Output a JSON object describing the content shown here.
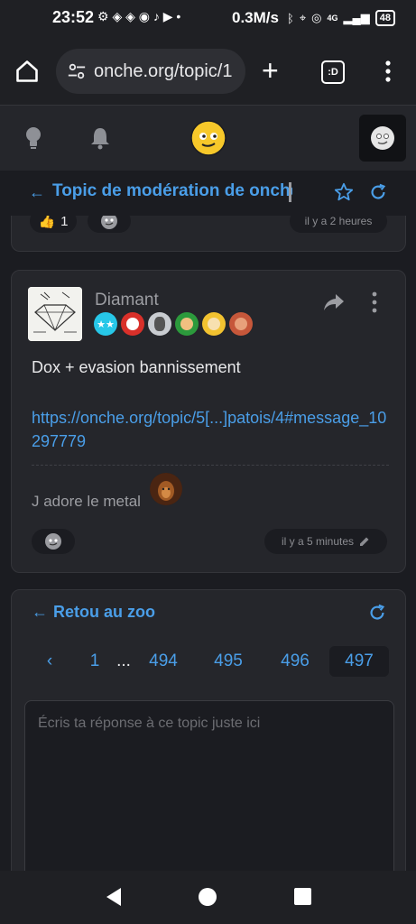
{
  "status_bar": {
    "time": "23:52",
    "network_speed": "0.3M/s",
    "signal_label": "4G",
    "battery": "48"
  },
  "browser": {
    "url": "onche.org/topic/1",
    "tabs_label": ":D"
  },
  "topic": {
    "title": "Topic de modération de onche"
  },
  "prev_post": {
    "likes": "1",
    "timestamp": "il y a 2 heures"
  },
  "post": {
    "username": "Diamant",
    "text": "Dox + evasion bannissement",
    "link": "https://onche.org/topic/5[...]patois/4#message_10297779",
    "signature": "J adore le metal",
    "timestamp": "il y a 5 minutes"
  },
  "reply": {
    "back_label": "Retou au zoo",
    "pages": [
      "1",
      "...",
      "494",
      "495",
      "496",
      "497"
    ],
    "active_page": "497",
    "placeholder": "Écris ta réponse à ce topic juste ici"
  },
  "colors": {
    "accent": "#4a9ee8",
    "background": "#1b1c21",
    "card": "#25262b"
  },
  "icons": [
    "home-icon",
    "tune-icon",
    "plus-icon",
    "tabs-icon",
    "more-vert-icon",
    "bulb-icon",
    "bell-icon",
    "smiley-logo-icon",
    "arrow-left-icon",
    "star-icon",
    "refresh-icon",
    "thumbs-up-icon",
    "share-icon",
    "pencil-icon"
  ]
}
